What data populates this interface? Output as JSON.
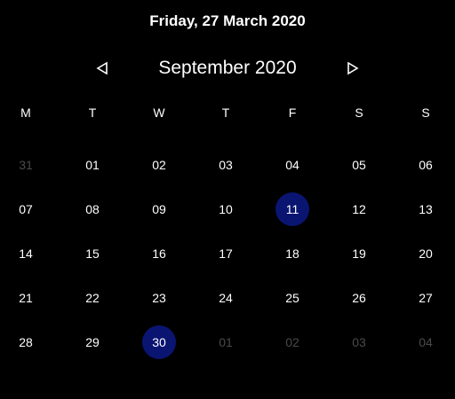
{
  "header": {
    "full_date": "Friday, 27 March 2020"
  },
  "nav": {
    "prev_icon": "triangle-left-icon",
    "next_icon": "triangle-right-icon",
    "month_label": "September 2020"
  },
  "weekdays": [
    "M",
    "T",
    "W",
    "T",
    "F",
    "S",
    "S"
  ],
  "weeks": [
    [
      {
        "label": "31",
        "other": true
      },
      {
        "label": "01"
      },
      {
        "label": "02"
      },
      {
        "label": "03"
      },
      {
        "label": "04"
      },
      {
        "label": "05"
      },
      {
        "label": "06"
      }
    ],
    [
      {
        "label": "07"
      },
      {
        "label": "08"
      },
      {
        "label": "09"
      },
      {
        "label": "10"
      },
      {
        "label": "11",
        "highlight": true
      },
      {
        "label": "12"
      },
      {
        "label": "13"
      }
    ],
    [
      {
        "label": "14"
      },
      {
        "label": "15"
      },
      {
        "label": "16"
      },
      {
        "label": "17"
      },
      {
        "label": "18"
      },
      {
        "label": "19"
      },
      {
        "label": "20"
      }
    ],
    [
      {
        "label": "21"
      },
      {
        "label": "22"
      },
      {
        "label": "23"
      },
      {
        "label": "24"
      },
      {
        "label": "25"
      },
      {
        "label": "26"
      },
      {
        "label": "27"
      }
    ],
    [
      {
        "label": "28"
      },
      {
        "label": "29"
      },
      {
        "label": "30",
        "highlight": true
      },
      {
        "label": "01",
        "other": true
      },
      {
        "label": "02",
        "other": true
      },
      {
        "label": "03",
        "other": true
      },
      {
        "label": "04",
        "other": true
      }
    ]
  ],
  "colors": {
    "background": "#000000",
    "text": "#ffffff",
    "muted_text": "#4a4a4a",
    "highlight": "#0a1572"
  }
}
